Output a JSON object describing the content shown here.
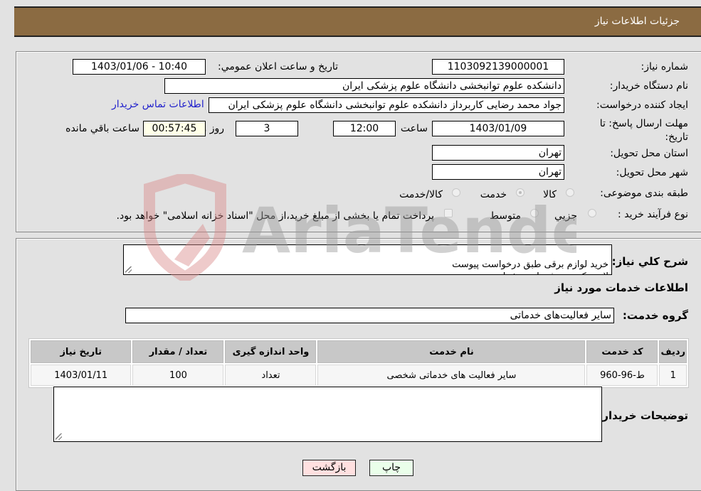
{
  "header": {
    "title": "جزئیات اطلاعات نیاز"
  },
  "form": {
    "need_number": {
      "label": "شماره نیاز:",
      "value": "1103092139000001"
    },
    "announce_datetime": {
      "label": "تاریخ و ساعت اعلان عمومي:",
      "value": "1403/01/06 - 10:40"
    },
    "buyer_org": {
      "label": "نام دستگاه خریدار:",
      "value": "دانشکده علوم توانبخشی دانشگاه علوم پزشکی ایران"
    },
    "requester": {
      "label": "ایجاد کننده درخواست:",
      "value": "جواد محمد رضایی کاربرداز دانشکده علوم توانبخشی دانشگاه علوم پزشکی ایران",
      "contact_link": "اطلاعات تماس خریدار"
    },
    "deadline": {
      "label": "مهلت ارسال پاسخ: تا تاریخ:",
      "date": "1403/01/09",
      "time_label": "ساعت",
      "time": "12:00",
      "days": "3",
      "days_label": "روز و",
      "remaining": "00:57:45",
      "remaining_label": "ساعت باقي مانده"
    },
    "province": {
      "label": "استان محل تحویل:",
      "value": "تهران"
    },
    "city": {
      "label": "شهر محل تحویل:",
      "value": "تهران"
    },
    "category": {
      "label": "طبقه بندی موضوعی:",
      "options": [
        "کالا",
        "خدمت",
        "کالا/خدمت"
      ],
      "selected": "خدمت"
    },
    "process_type": {
      "label": "نوع فرآیند خرید :",
      "options": [
        "جزیي",
        "متوسط"
      ],
      "selected": "",
      "treasury_note": "پرداخت تمام یا بخشی از مبلغ خرید،از محل \"اسناد خزانه اسلامی\" خواهد بود.",
      "treasury_checked": false
    }
  },
  "details": {
    "description_label": "شرح کلي نیاز:",
    "description": "خرید لوازم برقی طبق درخواست پیوست\nلامپ کم مصرف پارس شعاع",
    "services_heading": "اطلاعات خدمات مورد نیاز",
    "service_group_label": "گروه خدمت:",
    "service_group": "سایر فعالیت‌های خدماتی",
    "table": {
      "headers": [
        "ردیف",
        "کد خدمت",
        "نام خدمت",
        "واحد اندازه گیری",
        "تعداد / مقدار",
        "تاریخ نیاز"
      ],
      "rows": [
        [
          "1",
          "ط-96-960",
          "سایر فعالیت های خدماتی شخصی",
          "تعداد",
          "100",
          "1403/01/11"
        ]
      ]
    },
    "buyer_notes_label": "توضیحات خریدار:",
    "buyer_notes": ""
  },
  "buttons": {
    "print": "چاپ",
    "back": "بازگشت"
  },
  "watermark": {
    "text": "AriaTender.neT"
  },
  "colors": {
    "header_bg": "#8b6b42",
    "print_bg": "#eaffea",
    "back_bg": "#ffe0e0",
    "link": "#2222cc"
  }
}
